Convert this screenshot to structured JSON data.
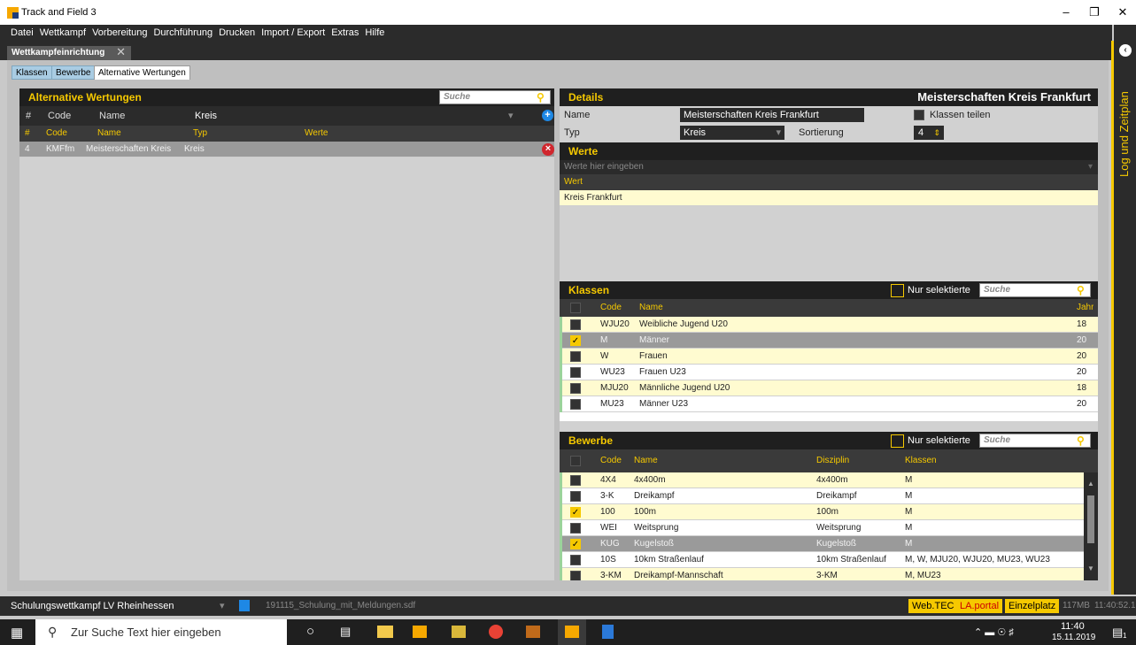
{
  "app": {
    "title": "Track and Field 3"
  },
  "menu": [
    "Datei",
    "Wettkampf",
    "Vorbereitung",
    "Durchführung",
    "Drucken",
    "Import / Export",
    "Extras",
    "Hilfe"
  ],
  "doc_tab": "Wettkampfeinrichtung",
  "subtabs": [
    "Klassen",
    "Bewerbe",
    "Alternative Wertungen"
  ],
  "right_panel_title": "Log und Zeitplan",
  "left": {
    "title": "Alternative Wertungen",
    "search_placeholder": "Suche",
    "filter": {
      "hash": "#",
      "code": "Code",
      "name": "Name",
      "value": "Kreis"
    },
    "columns": [
      "#",
      "Code",
      "Name",
      "Typ",
      "Werte"
    ],
    "rows": [
      {
        "num": "4",
        "code": "KMFfm",
        "name": "Meisterschaften Kreis",
        "typ": "Kreis",
        "werte": ""
      }
    ]
  },
  "details": {
    "title": "Details",
    "header_name": "Meisterschaften Kreis Frankfurt",
    "name_label": "Name",
    "name_value": "Meisterschaften Kreis Frankfurt",
    "typ_label": "Typ",
    "typ_value": "Kreis",
    "sort_label": "Sortierung",
    "sort_value": "4",
    "share_label": "Klassen teilen"
  },
  "werte": {
    "title": "Werte",
    "placeholder": "Werte hier eingeben",
    "column": "Wert",
    "rows": [
      "Kreis Frankfurt"
    ]
  },
  "klassen": {
    "title": "Klassen",
    "only_selected": "Nur selektierte",
    "search_placeholder": "Suche",
    "columns": [
      "Code",
      "Name",
      "Jahr"
    ],
    "rows": [
      {
        "checked": false,
        "code": "WJU20",
        "name": "Weibliche Jugend U20",
        "jahr": "18"
      },
      {
        "checked": true,
        "code": "M",
        "name": "Männer",
        "jahr": "20"
      },
      {
        "checked": false,
        "code": "W",
        "name": "Frauen",
        "jahr": "20"
      },
      {
        "checked": false,
        "code": "WU23",
        "name": "Frauen U23",
        "jahr": "20"
      },
      {
        "checked": false,
        "code": "MJU20",
        "name": "Männliche Jugend U20",
        "jahr": "18"
      },
      {
        "checked": false,
        "code": "MU23",
        "name": "Männer U23",
        "jahr": "20"
      }
    ]
  },
  "bewerbe": {
    "title": "Bewerbe",
    "only_selected": "Nur selektierte",
    "search_placeholder": "Suche",
    "columns": [
      "Code",
      "Name",
      "Disziplin",
      "Klassen"
    ],
    "rows": [
      {
        "checked": false,
        "code": "4X4",
        "name": "4x400m",
        "disziplin": "4x400m",
        "klassen": "M"
      },
      {
        "checked": false,
        "code": "3-K",
        "name": "Dreikampf",
        "disziplin": "Dreikampf",
        "klassen": "M"
      },
      {
        "checked": true,
        "code": "100",
        "name": "100m",
        "disziplin": "100m",
        "klassen": "M"
      },
      {
        "checked": false,
        "code": "WEI",
        "name": "Weitsprung",
        "disziplin": "Weitsprung",
        "klassen": "M"
      },
      {
        "checked": true,
        "code": "KUG",
        "name": "Kugelstoß",
        "disziplin": "Kugelstoß",
        "klassen": "M"
      },
      {
        "checked": false,
        "code": "10S",
        "name": "10km Straßenlauf",
        "disziplin": "10km Straßenlauf",
        "klassen": "M, W, MJU20, WJU20, MU23, WU23"
      },
      {
        "checked": false,
        "code": "3-KM",
        "name": "Dreikampf-Mannschaft",
        "disziplin": "3-KM",
        "klassen": "M, MU23"
      }
    ]
  },
  "status": {
    "competition": "Schulungswettkampf LV Rheinhessen",
    "file": "191115_Schulung_mit_Meldungen.sdf",
    "btn_webtec": "Web.TEC",
    "btn_laportal": "LA.portal",
    "btn_einzelplatz": "Einzelplatz",
    "memory": "117MB",
    "time": "11:40:52.1"
  },
  "taskbar": {
    "search_placeholder": "Zur Suche Text hier eingeben",
    "clock_time": "11:40",
    "clock_date": "15.11.2019",
    "notif_count": "1"
  },
  "colors": {
    "accent": "#f6c900",
    "dark": "#2b2b2b",
    "row_yellow": "#fffbd0",
    "delete_red": "#d0262d",
    "add_blue": "#1e88e5"
  }
}
